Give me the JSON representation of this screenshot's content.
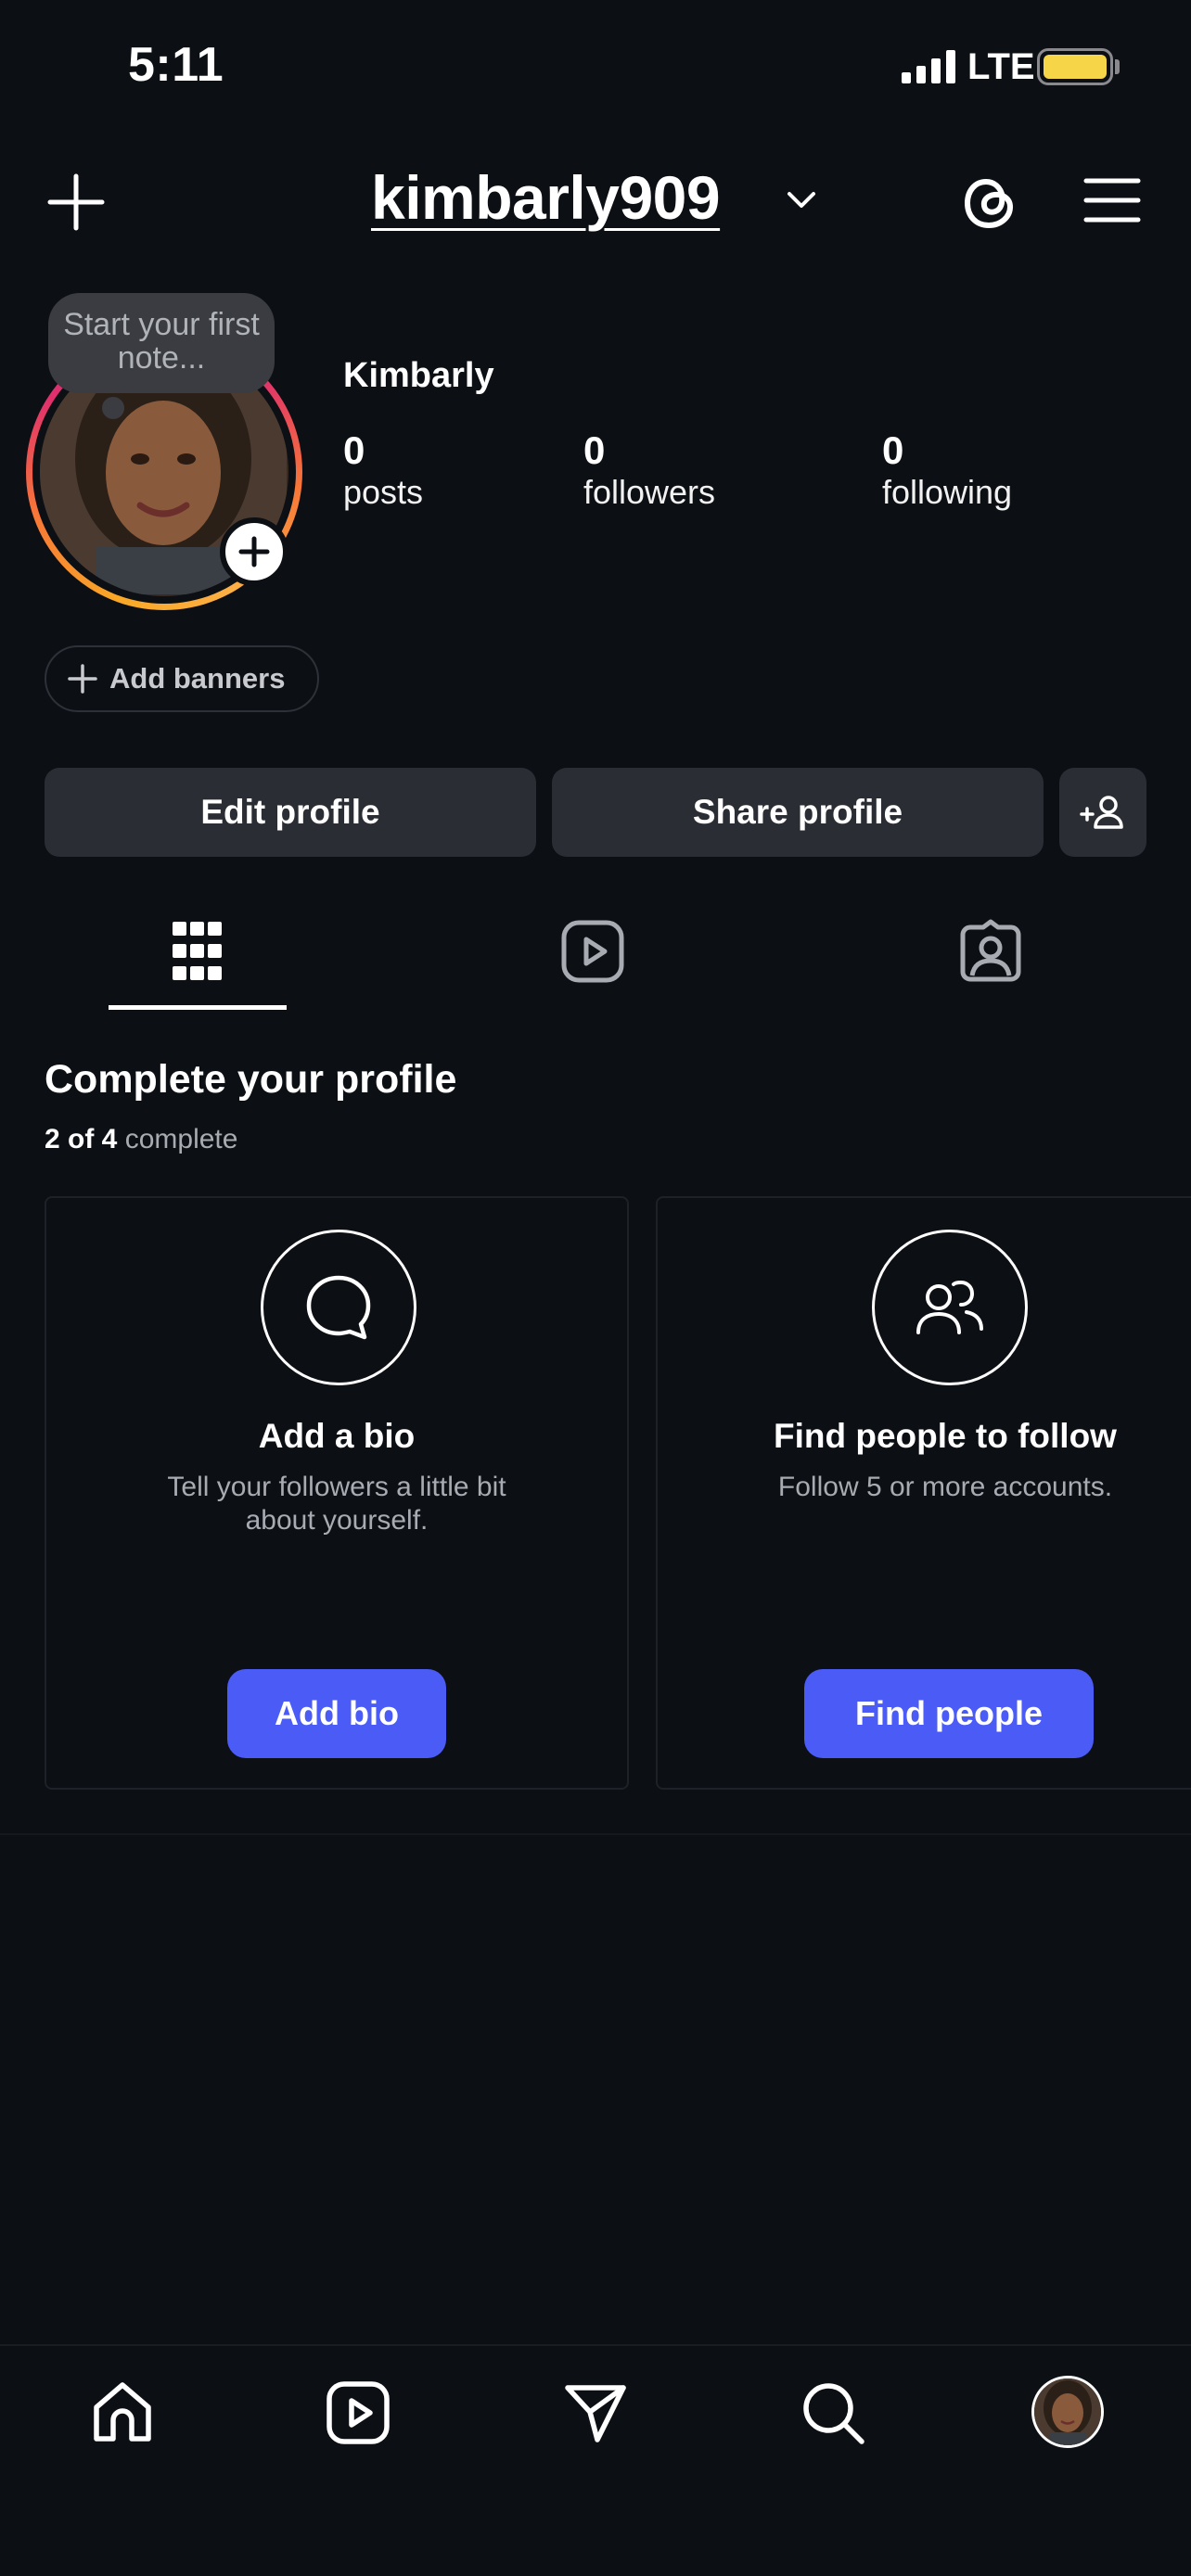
{
  "status_bar": {
    "time": "5:11",
    "network": "LTE",
    "battery_color": "#f7d548"
  },
  "header": {
    "username": "kimbarly909"
  },
  "profile": {
    "note_placeholder": "Start your first note...",
    "display_name": "Kimbarly",
    "stats": [
      {
        "value": "0",
        "label": "posts"
      },
      {
        "value": "0",
        "label": "followers"
      },
      {
        "value": "0",
        "label": "following"
      }
    ],
    "add_banners_label": "Add banners",
    "edit_profile_label": "Edit profile",
    "share_profile_label": "Share profile"
  },
  "tabs": [
    {
      "icon": "grid-icon",
      "active": true
    },
    {
      "icon": "reels-icon",
      "active": false
    },
    {
      "icon": "tagged-icon",
      "active": false
    }
  ],
  "complete_profile": {
    "title": "Complete your profile",
    "progress_count": "2 of 4",
    "progress_word": "complete",
    "cards": [
      {
        "icon": "speech-bubble-icon",
        "title": "Add a bio",
        "description": "Tell your followers a little bit about yourself.",
        "button": "Add bio"
      },
      {
        "icon": "people-icon",
        "title": "Find people to follow",
        "description": "Follow 5 or more accounts.",
        "button": "Find people"
      }
    ]
  },
  "bottom_nav": [
    {
      "icon": "home-icon"
    },
    {
      "icon": "reels-icon"
    },
    {
      "icon": "direct-send-icon"
    },
    {
      "icon": "search-icon"
    },
    {
      "icon": "profile-avatar"
    }
  ],
  "accent_colors": {
    "primary_button": "#4a5bf6",
    "background": "#0c0f14",
    "secondary_button": "#2a2d33"
  }
}
